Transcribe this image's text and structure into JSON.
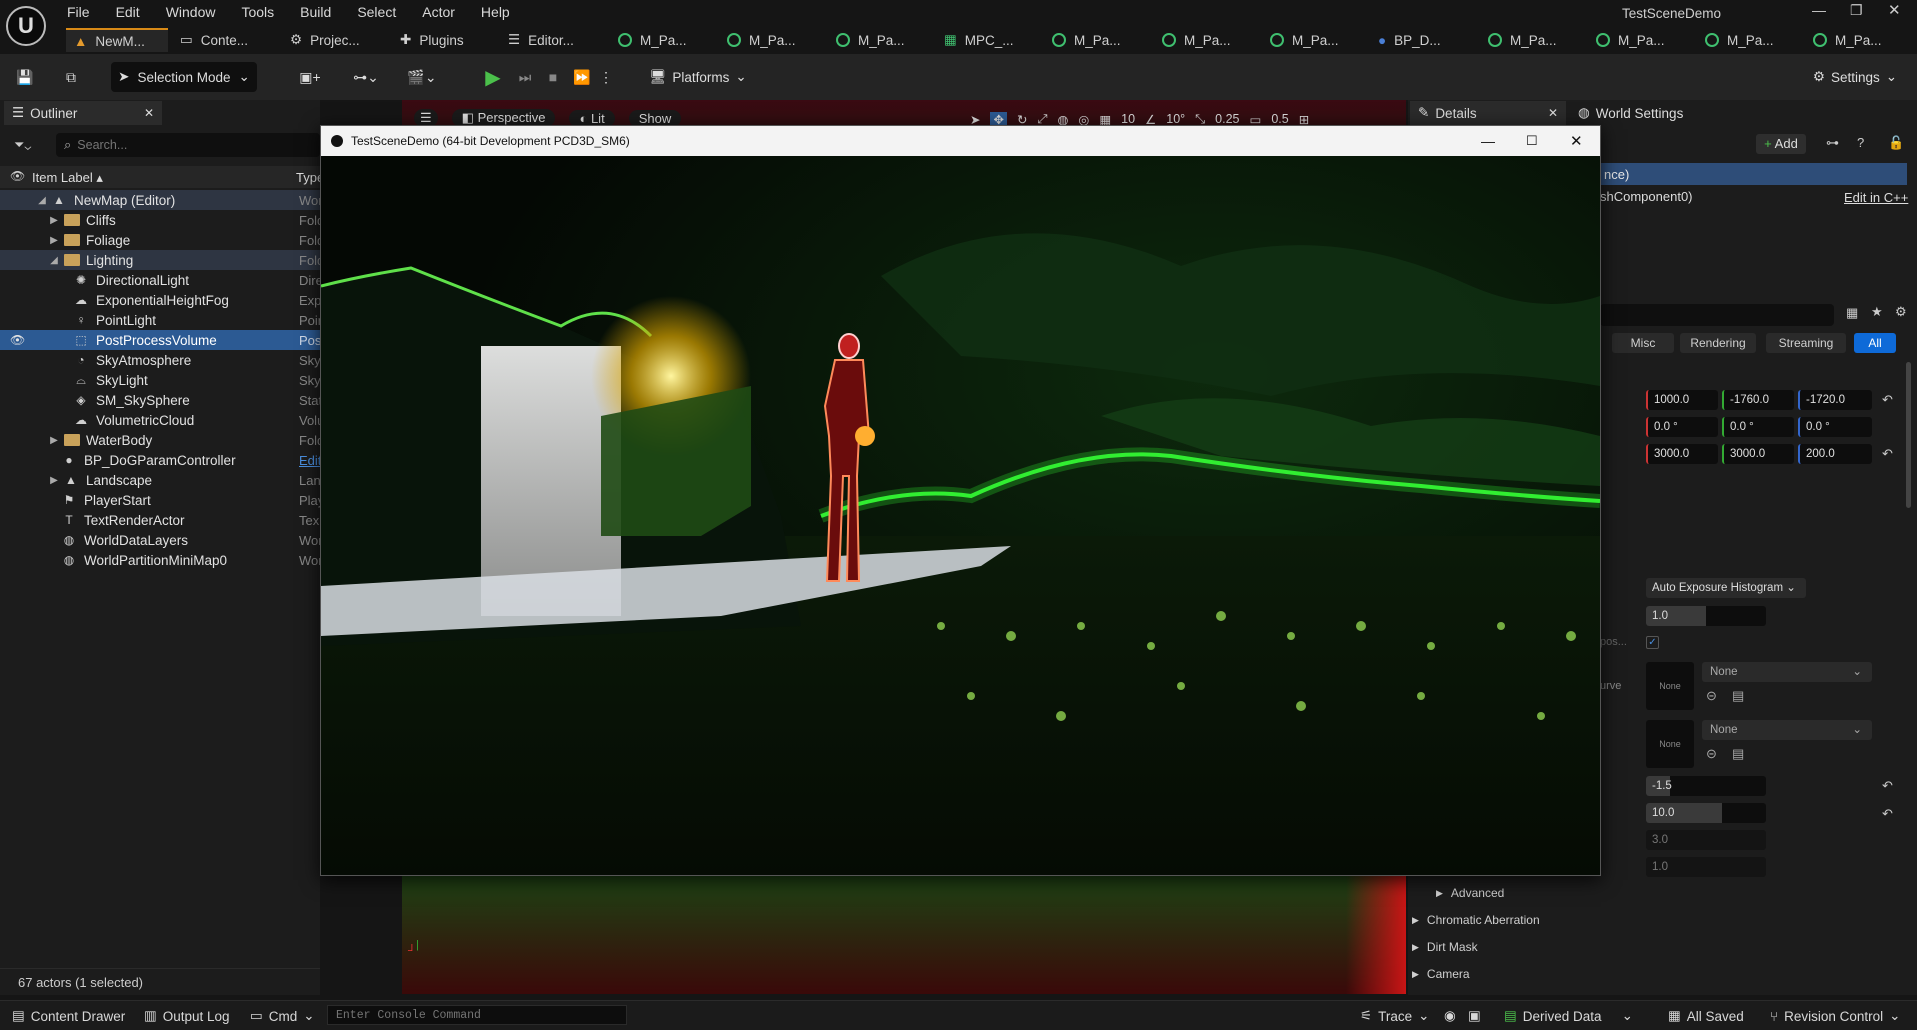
{
  "app": {
    "title": "TestSceneDemo"
  },
  "menu": [
    "File",
    "Edit",
    "Window",
    "Tools",
    "Build",
    "Select",
    "Actor",
    "Help"
  ],
  "tabs": [
    "NewM...",
    "Conte...",
    "Projec...",
    "Plugins",
    "Editor...",
    "M_Pa...",
    "M_Pa...",
    "M_Pa...",
    "MPC_...",
    "M_Pa...",
    "M_Pa...",
    "M_Pa...",
    "BP_D...",
    "M_Pa...",
    "M_Pa...",
    "M_Pa...",
    "M_Pa..."
  ],
  "toolbar": {
    "selection_mode": "Selection Mode",
    "platforms": "Platforms",
    "settings": "Settings"
  },
  "outliner": {
    "title": "Outliner",
    "search_placeholder": "Search...",
    "col_label": "Item Label",
    "col_type": "Type",
    "status": "67 actors (1 selected)",
    "rows": [
      {
        "label": "NewMap (Editor)",
        "type": "Wor"
      },
      {
        "label": "Cliffs",
        "type": "Fold"
      },
      {
        "label": "Foliage",
        "type": "Fold"
      },
      {
        "label": "Lighting",
        "type": "Fold"
      },
      {
        "label": "DirectionalLight",
        "type": "Dire"
      },
      {
        "label": "ExponentialHeightFog",
        "type": "Exp"
      },
      {
        "label": "PointLight",
        "type": "Poin"
      },
      {
        "label": "PostProcessVolume",
        "type": "Pos"
      },
      {
        "label": "SkyAtmosphere",
        "type": "Sky"
      },
      {
        "label": "SkyLight",
        "type": "Sky"
      },
      {
        "label": "SM_SkySphere",
        "type": "Stat"
      },
      {
        "label": "VolumetricCloud",
        "type": "Volu"
      },
      {
        "label": "WaterBody",
        "type": "Fold"
      },
      {
        "label": "BP_DoGParamController",
        "type": "Edit"
      },
      {
        "label": "Landscape",
        "type": "Lan"
      },
      {
        "label": "PlayerStart",
        "type": "Play"
      },
      {
        "label": "TextRenderActor",
        "type": "Tex"
      },
      {
        "label": "WorldDataLayers",
        "type": "Wor"
      },
      {
        "label": "WorldPartitionMiniMap0",
        "type": "Wor"
      }
    ]
  },
  "viewport": {
    "perspective": "Perspective",
    "lit": "Lit",
    "show": "Show",
    "grid": "10",
    "angle": "10°",
    "scale": "0.25",
    "cam": "0.5"
  },
  "game_window": {
    "title": "TestSceneDemo (64-bit Development PCD3D_SM6)"
  },
  "details": {
    "title": "Details",
    "world_settings": "World Settings",
    "add": "Add",
    "instance": "nce)",
    "component": "shComponent0)",
    "edit_cpp": "Edit in C++",
    "filters": [
      "Misc",
      "Rendering",
      "Streaming",
      "All"
    ],
    "location": [
      "1000.0",
      "-1760.0",
      "-1720.0"
    ],
    "rotation": [
      "0.0 °",
      "0.0 °",
      "0.0 °"
    ],
    "scale": [
      "3000.0",
      "3000.0",
      "200.0"
    ],
    "exposure_method": "Auto Exposure Histogram",
    "compensation": "1.0",
    "frag_pos": "pos...",
    "frag_curve": "urve",
    "none": "None",
    "min_ev": "-1.5",
    "max_ev": "10.0",
    "speed_up": "3.0",
    "speed_down": "1.0",
    "categories": [
      "Advanced",
      "Chromatic Aberration",
      "Dirt Mask",
      "Camera"
    ]
  },
  "statusbar": {
    "content_drawer": "Content Drawer",
    "output_log": "Output Log",
    "cmd": "Cmd",
    "console_placeholder": "Enter Console Command",
    "trace": "Trace",
    "derived_data": "Derived Data",
    "all_saved": "All Saved",
    "revision_control": "Revision Control"
  }
}
